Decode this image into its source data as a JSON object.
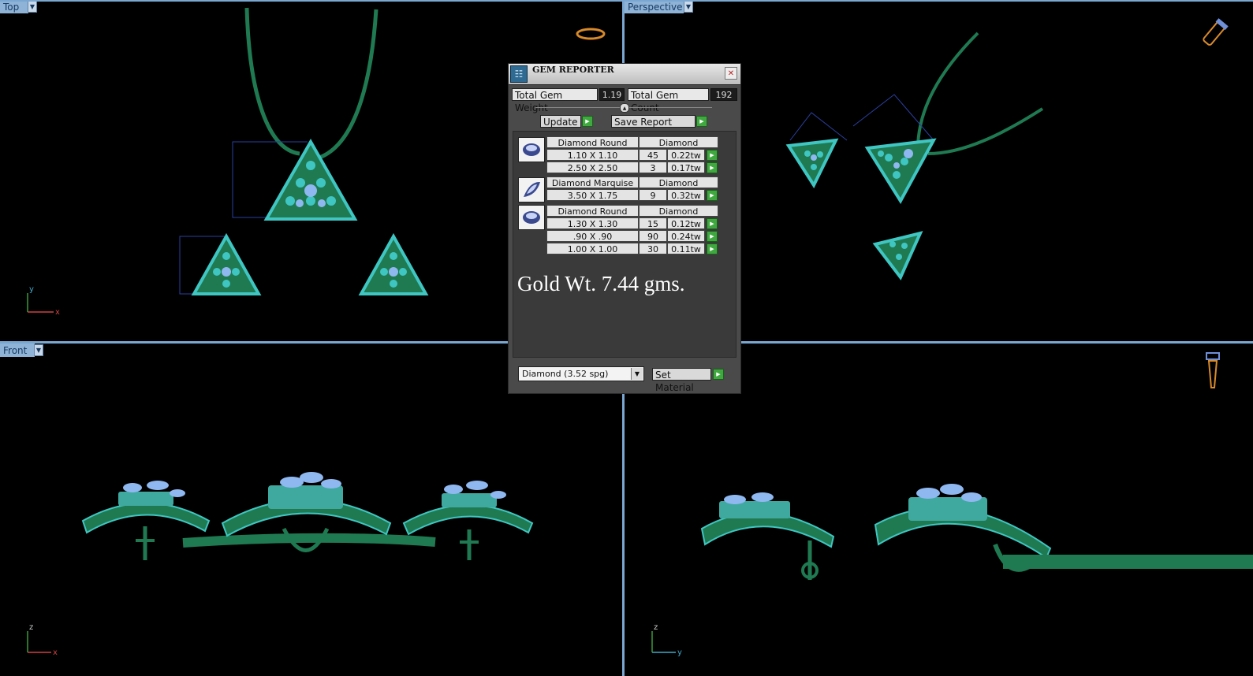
{
  "viewports": {
    "top": {
      "label": "Top"
    },
    "perspective": {
      "label": "Perspective"
    },
    "front": {
      "label": "Front"
    },
    "right": {
      "label": ""
    }
  },
  "axes": {
    "x": "x",
    "y": "y",
    "z": "z"
  },
  "gem_reporter": {
    "title": "GEM REPORTER",
    "total_weight_label": "Total Gem Weight",
    "total_weight_value": "1.19",
    "total_count_label": "Total Gem Count",
    "total_count_value": "192",
    "update_label": "Update",
    "save_report_label": "Save Report",
    "groups": [
      {
        "shape": "Diamond Round",
        "material": "Diamond",
        "rows": [
          {
            "size": "1.10 X 1.10",
            "count": "45",
            "weight": "0.22tw"
          },
          {
            "size": "2.50 X 2.50",
            "count": "3",
            "weight": "0.17tw"
          }
        ]
      },
      {
        "shape": "Diamond Marquise",
        "material": "Diamond",
        "rows": [
          {
            "size": "3.50 X 1.75",
            "count": "9",
            "weight": "0.32tw"
          }
        ]
      },
      {
        "shape": "Diamond Round",
        "material": "Diamond",
        "rows": [
          {
            "size": "1.30 X 1.30",
            "count": "15",
            "weight": "0.12tw"
          },
          {
            "size": ".90 X .90",
            "count": "90",
            "weight": "0.24tw"
          },
          {
            "size": "1.00 X 1.00",
            "count": "30",
            "weight": "0.11tw"
          }
        ]
      }
    ],
    "note": "Gold Wt. 7.44 gms.",
    "material_select": "Diamond    (3.52 spg)",
    "set_material_label": "Set Material"
  },
  "colors": {
    "metal": "#1f7a52",
    "gem": "#3fc6c2",
    "gem_center": "#8fb8f0",
    "viewport_label_bg": "#8fb3d6"
  }
}
